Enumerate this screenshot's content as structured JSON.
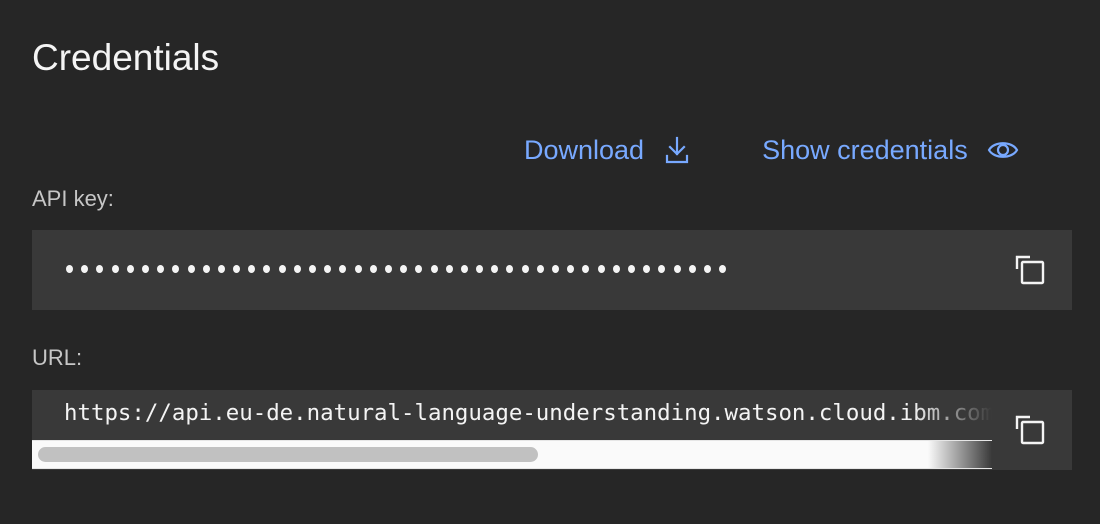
{
  "section": {
    "title": "Credentials"
  },
  "actions": {
    "download": {
      "label": "Download",
      "icon": "download-icon"
    },
    "show_credentials": {
      "label": "Show credentials",
      "icon": "eye-icon"
    }
  },
  "fields": {
    "api_key": {
      "label": "API key:",
      "masked_value": "••••••••••••••••••••••••••••••••••••••••••••",
      "masked_length": 44,
      "copy_icon": "copy-icon"
    },
    "url": {
      "label": "URL:",
      "value": "https://api.eu-de.natural-language-understanding.watson.cloud.ibm.com",
      "copy_icon": "copy-icon"
    }
  },
  "colors": {
    "background": "#262626",
    "field_background": "#393939",
    "link": "#78a9ff",
    "text_primary": "#f4f4f4",
    "text_secondary": "#c6c6c6"
  }
}
